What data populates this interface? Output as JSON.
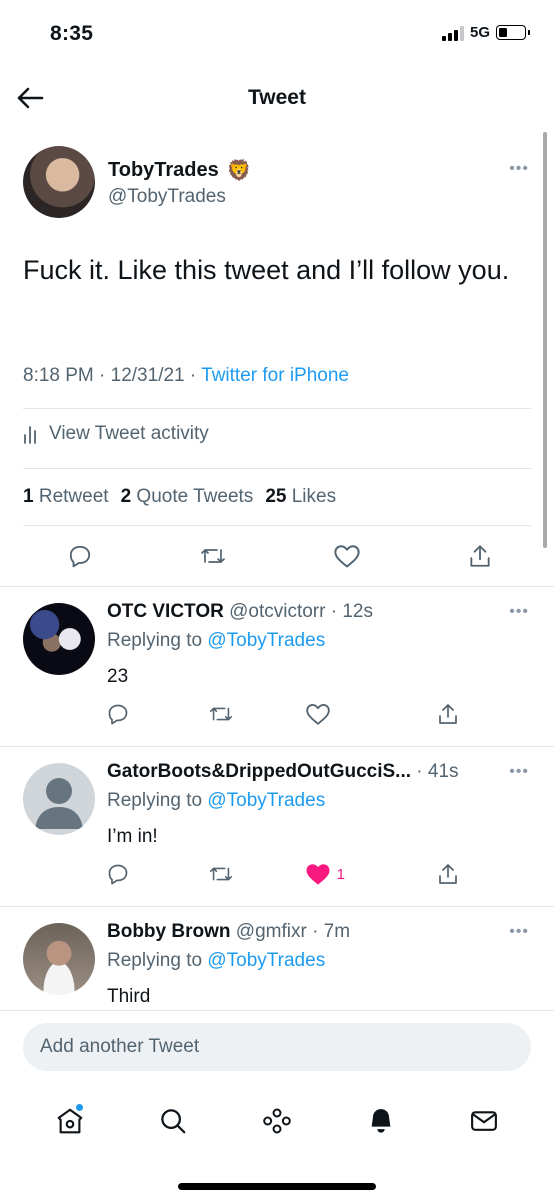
{
  "status": {
    "time": "8:35",
    "network": "5G",
    "battery_level": 0.35
  },
  "header": {
    "title": "Tweet",
    "back_icon": "arrow-left-icon"
  },
  "main_tweet": {
    "name": "TobyTrades",
    "emoji": "🦁",
    "handle": "@TobyTrades",
    "text": "Fuck it. Like this tweet and I’ll follow you.",
    "time_date": "8:18 PM · 12/31/21 · ",
    "source": "Twitter for iPhone",
    "activity_label": "View Tweet activity",
    "retweets": "1",
    "retweets_label": "Retweet",
    "quotes": "2",
    "quotes_label": "Quote Tweets",
    "likes": "25",
    "likes_label": "Likes"
  },
  "replies": [
    {
      "name": "OTC VICTOR",
      "handle_time": " @otcvictorr · 12s",
      "replying_prefix": "Replying to ",
      "replying_to": "@TobyTrades",
      "text": "23",
      "liked": false,
      "like_count": ""
    },
    {
      "name": "GatorBoots&DrippedOutGucciS...",
      "handle_time": " · 41s",
      "replying_prefix": "Replying to ",
      "replying_to": "@TobyTrades",
      "text": "I’m in!",
      "liked": true,
      "like_count": "1"
    },
    {
      "name": "Bobby Brown",
      "handle_time": " @gmfixr · 7m",
      "replying_prefix": "Replying to ",
      "replying_to": "@TobyTrades",
      "text": "Third",
      "liked": false,
      "like_count": ""
    }
  ],
  "compose": {
    "placeholder": "Add another Tweet"
  },
  "tabs": [
    {
      "icon": "home-icon",
      "notification_dot": true
    },
    {
      "icon": "search-icon"
    },
    {
      "icon": "spaces-icon"
    },
    {
      "icon": "bell-icon"
    },
    {
      "icon": "mail-icon"
    }
  ],
  "colors": {
    "accent": "#1d9bf0",
    "like": "#f91880",
    "secondary_text": "#536471"
  }
}
